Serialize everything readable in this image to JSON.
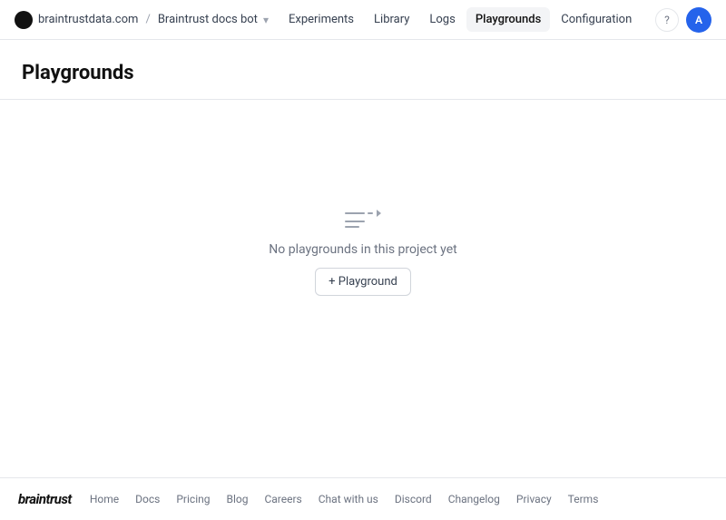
{
  "brand": {
    "site": "braintrustdata.com",
    "project": "Braintrust docs bot"
  },
  "nav": {
    "links": [
      {
        "label": "Experiments",
        "active": false
      },
      {
        "label": "Library",
        "active": false
      },
      {
        "label": "Logs",
        "active": false
      },
      {
        "label": "Playgrounds",
        "active": true
      },
      {
        "label": "Configuration",
        "active": false
      }
    ]
  },
  "user": {
    "initials": "A"
  },
  "page": {
    "title": "Playgrounds"
  },
  "empty": {
    "message": "No playgrounds in this project yet",
    "add_button": "+ Playground"
  },
  "footer": {
    "logo": "braintrust",
    "links": [
      {
        "label": "Home"
      },
      {
        "label": "Docs"
      },
      {
        "label": "Pricing"
      },
      {
        "label": "Blog"
      },
      {
        "label": "Careers"
      },
      {
        "label": "Chat with us"
      },
      {
        "label": "Discord"
      },
      {
        "label": "Changelog"
      },
      {
        "label": "Privacy"
      },
      {
        "label": "Terms"
      }
    ]
  }
}
